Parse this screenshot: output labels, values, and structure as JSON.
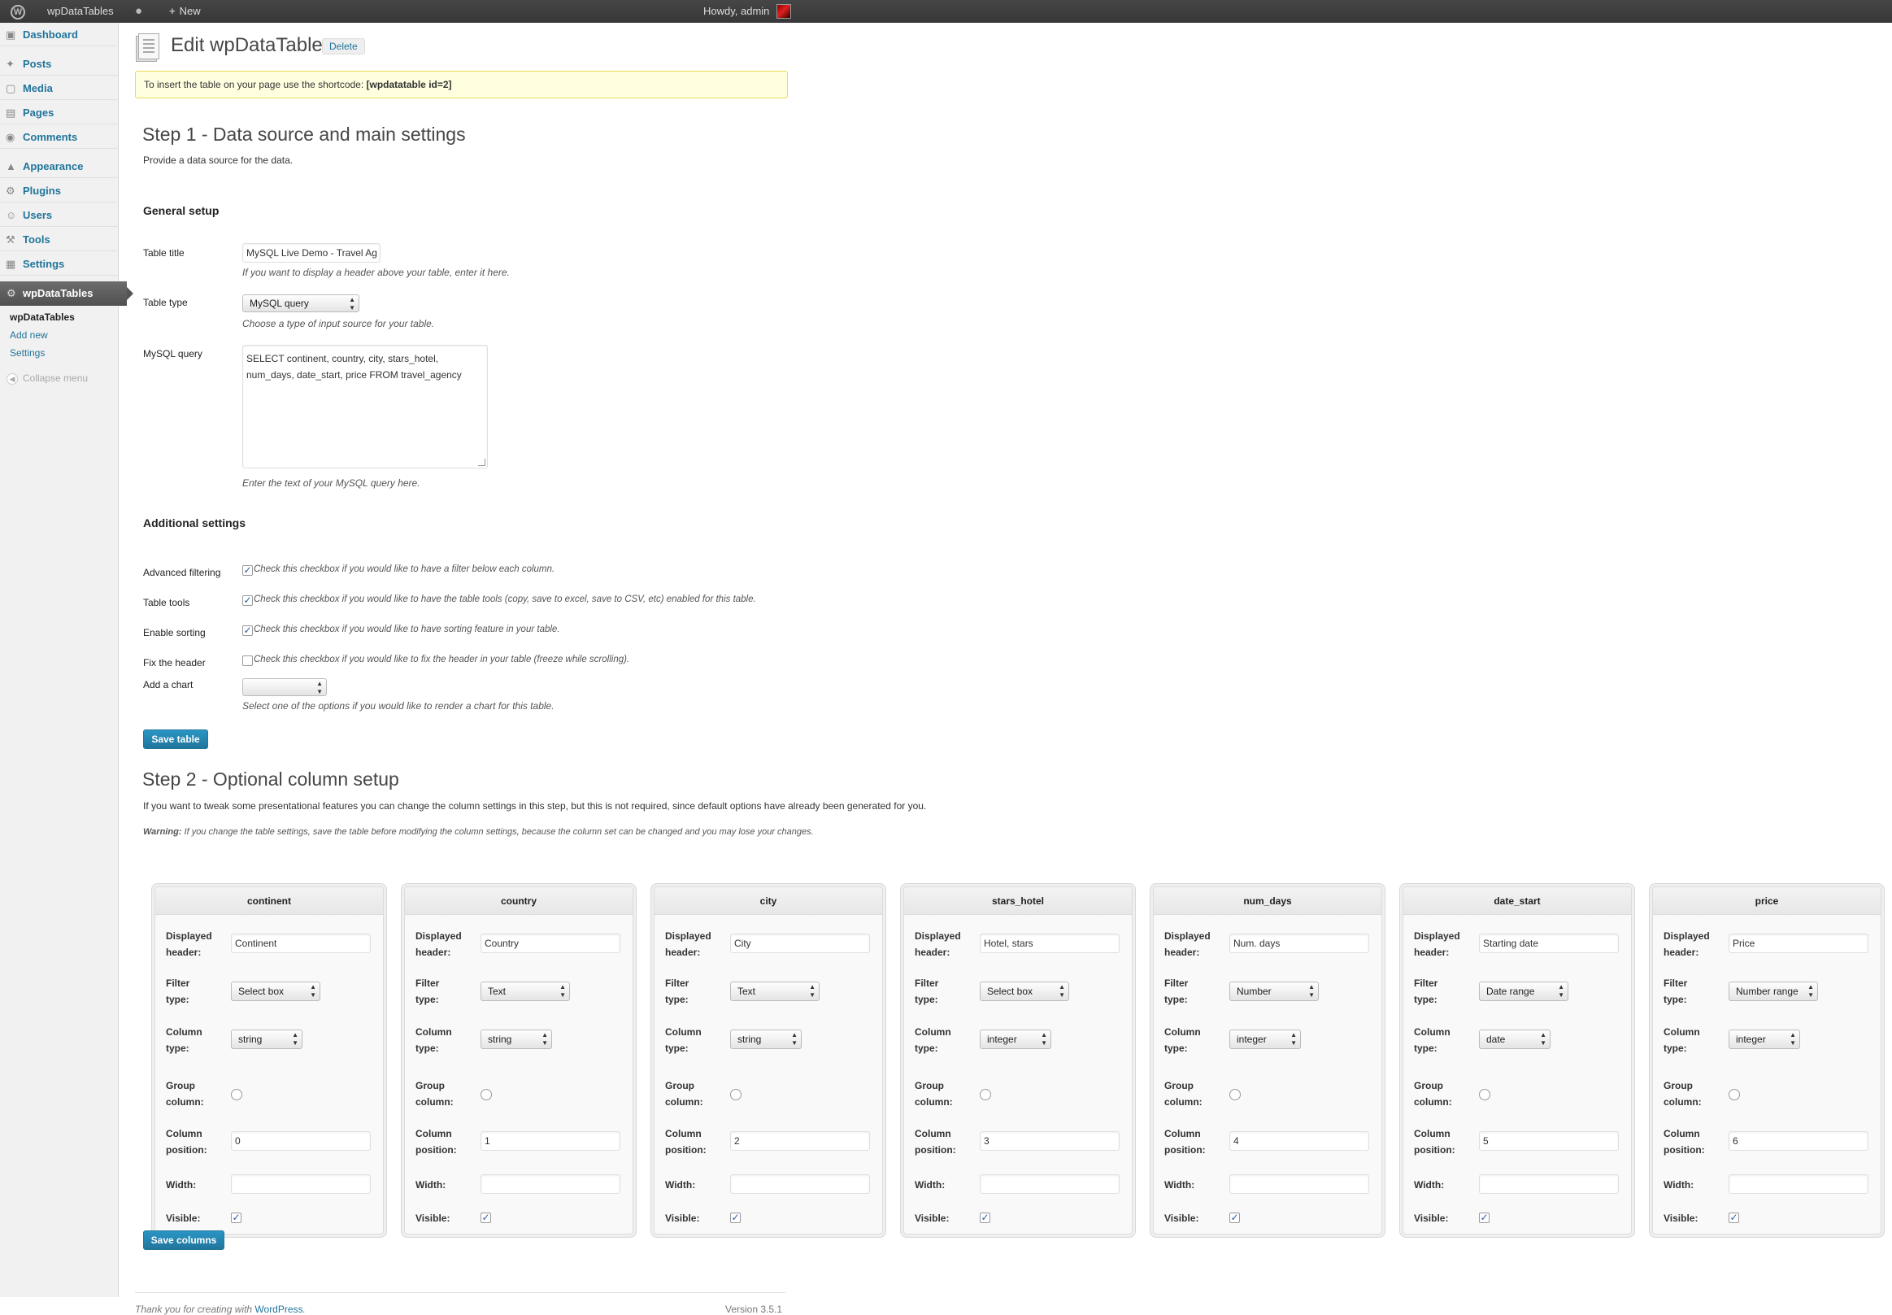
{
  "admin_bar": {
    "site_name": "wpDataTables",
    "new_label": "New",
    "howdy": "Howdy, admin"
  },
  "sidebar": {
    "items": [
      {
        "label": "Dashboard",
        "icon": "dashboard-icon"
      },
      {
        "label": "Posts",
        "icon": "pin-icon"
      },
      {
        "label": "Media",
        "icon": "media-icon"
      },
      {
        "label": "Pages",
        "icon": "pages-icon"
      },
      {
        "label": "Comments",
        "icon": "comment-icon"
      },
      {
        "label": "Appearance",
        "icon": "appearance-icon"
      },
      {
        "label": "Plugins",
        "icon": "plugin-icon"
      },
      {
        "label": "Users",
        "icon": "users-icon"
      },
      {
        "label": "Tools",
        "icon": "tools-icon"
      },
      {
        "label": "Settings",
        "icon": "settings-icon"
      }
    ],
    "active": {
      "label": "wpDataTables",
      "icon": "gear-icon"
    },
    "submenu": [
      "wpDataTables",
      "Add new",
      "Settings"
    ],
    "collapse": "Collapse menu"
  },
  "page": {
    "title": "Edit wpDataTable",
    "delete_label": "Delete",
    "notice_text": "To insert the table on your page use the shortcode: ",
    "notice_code": "[wpdatatable id=2]"
  },
  "step1": {
    "title": "Step 1 - Data source and main settings",
    "description": "Provide a data source for the data.",
    "general_heading": "General setup",
    "table_title_label": "Table title",
    "table_title_value": "MySQL Live Demo - Travel Ag",
    "table_title_hint": "If you want to display a header above your table, enter it here.",
    "table_type_label": "Table type",
    "table_type_value": "MySQL query",
    "table_type_hint": "Choose a type of input source for your table.",
    "mysql_label": "MySQL query",
    "mysql_line1": "SELECT continent, country, city, stars_hotel,",
    "mysql_line2": "num_days, date_start, price FROM travel_agency",
    "mysql_hint": "Enter the text of your MySQL query here.",
    "additional_heading": "Additional settings",
    "options": [
      {
        "label": "Advanced filtering",
        "checked": true,
        "hint": "Check this checkbox if you would like to have a filter below each column."
      },
      {
        "label": "Table tools",
        "checked": true,
        "hint": "Check this checkbox if you would like to have the table tools (copy, save to excel, save to CSV, etc) enabled for this table."
      },
      {
        "label": "Enable sorting",
        "checked": true,
        "hint": "Check this checkbox if you would like to have sorting feature in your table."
      },
      {
        "label": "Fix the header",
        "checked": false,
        "hint": "Check this checkbox if you would like to fix the header in your table (freeze while scrolling)."
      }
    ],
    "chart_label": "Add a chart",
    "chart_value": "",
    "chart_hint": "Select one of the options if you would like to render a chart for this table.",
    "save_label": "Save table"
  },
  "step2": {
    "title": "Step 2 - Optional column setup",
    "description": "If you want to tweak some presentational features you can change the column settings in this step, but this is not required, since default options have already been generated for you.",
    "warning_label": "Warning:",
    "warning_text": " If you change the table settings, save the table before modifying the column settings, because the column set can be changed and you may lose your changes.",
    "labels": {
      "displayed1": "Displayed",
      "displayed2": "header:",
      "filter1": "Filter",
      "filter2": "type:",
      "coltype1": "Column",
      "coltype2": "type:",
      "group1": "Group",
      "group2": "column:",
      "position1": "Column",
      "position2": "position:",
      "width": "Width:",
      "visible": "Visible:"
    },
    "columns": [
      {
        "name": "continent",
        "header": "Continent",
        "filter": "Select box",
        "type": "string",
        "position": "0",
        "visible": true
      },
      {
        "name": "country",
        "header": "Country",
        "filter": "Text",
        "type": "string",
        "position": "1",
        "visible": true
      },
      {
        "name": "city",
        "header": "City",
        "filter": "Text",
        "type": "string",
        "position": "2",
        "visible": true
      },
      {
        "name": "stars_hotel",
        "header": "Hotel, stars",
        "filter": "Select box",
        "type": "integer",
        "position": "3",
        "visible": true
      },
      {
        "name": "num_days",
        "header": "Num. days",
        "filter": "Number",
        "type": "integer",
        "position": "4",
        "visible": true
      },
      {
        "name": "date_start",
        "header": "Starting date",
        "filter": "Date range",
        "type": "date",
        "position": "5",
        "visible": true
      },
      {
        "name": "price",
        "header": "Price",
        "filter": "Number range",
        "type": "integer",
        "position": "6",
        "visible": true
      }
    ],
    "save_label": "Save columns"
  },
  "footer": {
    "thanks": "Thank you for creating with ",
    "wp_link": "WordPress",
    "period": ".",
    "version": "Version 3.5.1"
  },
  "colors": {
    "link": "#21759b",
    "adminbar": "#464646",
    "notice_bg": "#ffffe0",
    "notice_border": "#e6db55",
    "button": "#21759b"
  }
}
